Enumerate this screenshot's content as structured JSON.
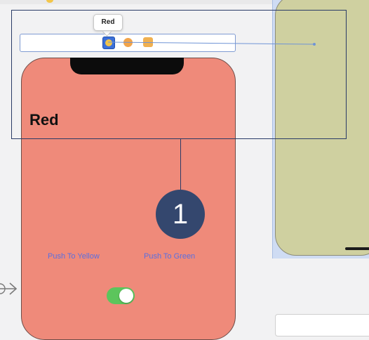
{
  "scene": {
    "tooltip_label": "Red",
    "red_title": "Red",
    "push_yellow_label": "Push To Yellow",
    "push_green_label": "Push To Green",
    "toggle_on": true
  },
  "callout": {
    "number": "1"
  },
  "colors": {
    "red_view": "#ef8a7a",
    "green_view": "#cfd0a0",
    "link_blue": "#5a6fe0",
    "switch_on": "#5cc55c",
    "callout_navy": "#34476e"
  },
  "icons": [
    "view-controller-icon",
    "first-responder-icon",
    "exit-icon",
    "entry-arrow-icon"
  ]
}
